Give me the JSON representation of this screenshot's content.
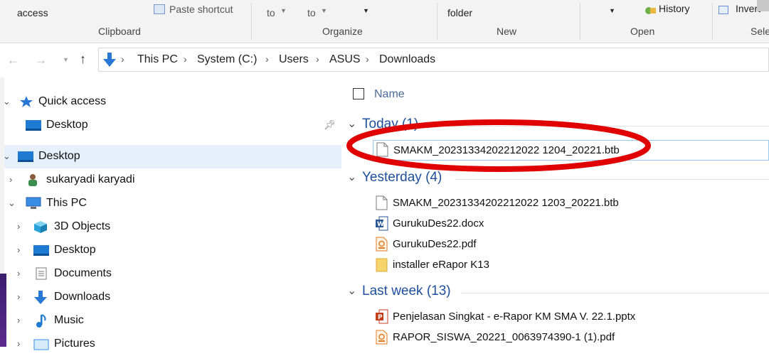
{
  "ribbon": {
    "top_labels": {
      "access": "access",
      "paste_shortcut": "Paste shortcut",
      "move_to": "to",
      "copy_to": "to",
      "new_folder": "folder",
      "history": "History",
      "invert": "Invert"
    },
    "groups": {
      "clipboard": "Clipboard",
      "organize": "Organize",
      "new": "New",
      "open": "Open",
      "select": "Sele"
    }
  },
  "address": {
    "breadcrumbs": [
      "This PC",
      "System (C:)",
      "Users",
      "ASUS",
      "Downloads"
    ]
  },
  "nav": {
    "items": [
      {
        "label": "Quick access"
      },
      {
        "label": "Desktop"
      },
      {
        "label": "Desktop"
      },
      {
        "label": "sukaryadi karyadi"
      },
      {
        "label": "This PC"
      },
      {
        "label": "3D Objects"
      },
      {
        "label": "Desktop"
      },
      {
        "label": "Documents"
      },
      {
        "label": "Downloads"
      },
      {
        "label": "Music"
      },
      {
        "label": "Pictures"
      }
    ]
  },
  "content": {
    "column_header": "Name",
    "groups": [
      {
        "title": "Today (1)",
        "files": [
          "SMAKM_20231334202212022 1204_20221.btb"
        ]
      },
      {
        "title": "Yesterday (4)",
        "files": [
          "SMAKM_20231334202212022 1203_20221.btb",
          "GurukuDes22.docx",
          "GurukuDes22.pdf",
          "installer eRapor K13"
        ]
      },
      {
        "title": "Last week (13)",
        "files": [
          "Penjelasan Singkat - e-Rapor KM SMA V. 22.1.pptx",
          "RAPOR_SISWA_20221_0063974390-1 (1).pdf"
        ]
      }
    ]
  },
  "highlight_color": "#e00000"
}
